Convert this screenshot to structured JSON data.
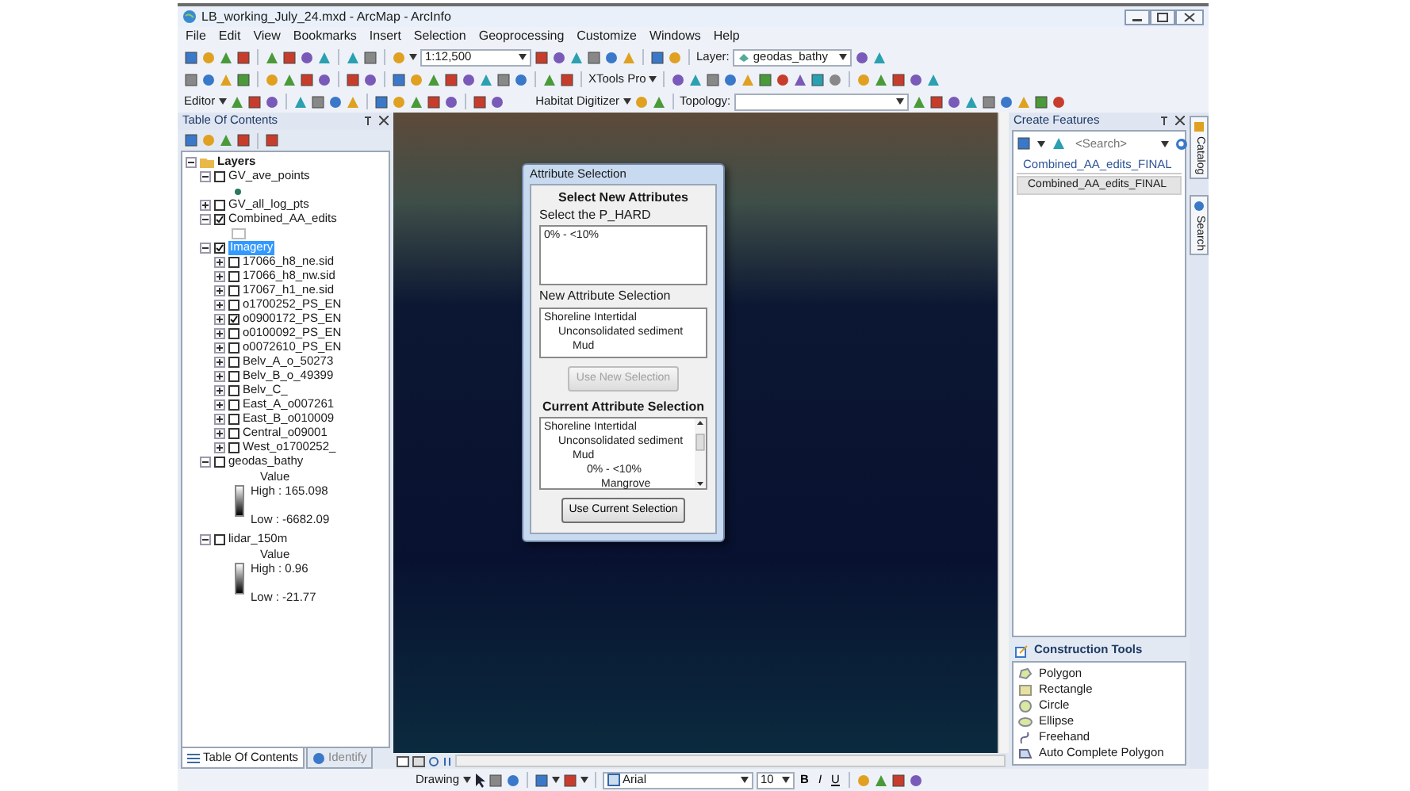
{
  "window": {
    "title": "LB_working_July_24.mxd - ArcMap - ArcInfo"
  },
  "menu": [
    "File",
    "Edit",
    "View",
    "Bookmarks",
    "Insert",
    "Selection",
    "Geoprocessing",
    "Customize",
    "Windows",
    "Help"
  ],
  "standard_toolbar": {
    "scale": "1:12,500",
    "layer_label": "Layer:",
    "layer_value": "geodas_bathy"
  },
  "tools_toolbar": {
    "xtools": "XTools Pro"
  },
  "editor_toolbar": {
    "editor": "Editor",
    "habitat": "Habitat Digitizer",
    "topology": "Topology:"
  },
  "toc": {
    "title": "Table Of Contents",
    "tree": {
      "label": "Layers",
      "expanded": true,
      "children": [
        {
          "label": "GV_ave_points",
          "checked": false,
          "expanded": true,
          "kind": "point"
        },
        {
          "label": "GV_all_log_pts",
          "checked": false,
          "expanded": false
        },
        {
          "label": "Combined_AA_edits",
          "checked": true,
          "expanded": true,
          "kind": "polygon"
        },
        {
          "label": "Imagery",
          "checked": true,
          "expanded": true,
          "selected": true,
          "children": [
            {
              "label": "17066_h8_ne.sid",
              "checked": false,
              "expanded": false
            },
            {
              "label": "17066_h8_nw.sid",
              "checked": false,
              "expanded": false
            },
            {
              "label": "17067_h1_ne.sid",
              "checked": false,
              "expanded": false
            },
            {
              "label": "o1700252_PS_EN",
              "checked": false,
              "expanded": false
            },
            {
              "label": "o0900172_PS_EN",
              "checked": true,
              "expanded": false
            },
            {
              "label": "o0100092_PS_EN",
              "checked": false,
              "expanded": false
            },
            {
              "label": "o0072610_PS_EN",
              "checked": false,
              "expanded": false
            },
            {
              "label": "Belv_A_o_50273",
              "checked": false,
              "expanded": false
            },
            {
              "label": "Belv_B_o_49399",
              "checked": false,
              "expanded": false
            },
            {
              "label": "Belv_C_",
              "checked": false,
              "expanded": false
            },
            {
              "label": "East_A_o007261",
              "checked": false,
              "expanded": false
            },
            {
              "label": "East_B_o010009",
              "checked": false,
              "expanded": false
            },
            {
              "label": "Central_o09001",
              "checked": false,
              "expanded": false
            },
            {
              "label": "West_o1700252_",
              "checked": false,
              "expanded": false
            }
          ]
        },
        {
          "label": "geodas_bathy",
          "checked": false,
          "expanded": true,
          "legend": {
            "title": "Value",
            "high": "High : 165.098",
            "low": "Low : -6682.09"
          }
        },
        {
          "label": "lidar_150m",
          "checked": false,
          "expanded": true,
          "legend": {
            "title": "Value",
            "high": "High : 0.96",
            "low": "Low : -21.77"
          }
        }
      ]
    },
    "tabs": [
      {
        "label": "Table Of Contents",
        "selected": true
      },
      {
        "label": "Identify",
        "selected": false
      }
    ]
  },
  "dialog": {
    "title": "Attribute Selection",
    "heading": "Select New Attributes",
    "list_label": "Select the P_HARD",
    "options": [
      "0% - <10%"
    ],
    "new_label": "New Attribute Selection",
    "new_selection": [
      {
        "label": "Shoreline Intertidal",
        "children": [
          {
            "label": "Unconsolidated sediment",
            "children": [
              {
                "label": "Mud"
              }
            ]
          }
        ]
      }
    ],
    "use_new": {
      "label": "Use New Selection",
      "disabled": true
    },
    "current_heading": "Current Attribute Selection",
    "current_selection": [
      {
        "label": "Shoreline Intertidal",
        "children": [
          {
            "label": "Unconsolidated sediment",
            "children": [
              {
                "label": "Mud",
                "children": [
                  {
                    "label": "0% - <10%",
                    "children": [
                      {
                        "label": "Mangrove"
                      }
                    ]
                  }
                ]
              }
            ]
          }
        ]
      }
    ],
    "use_current": {
      "label": "Use Current Selection",
      "disabled": false
    }
  },
  "create_features": {
    "title": "Create Features",
    "search_placeholder": "<Search>",
    "group": "Combined_AA_edits_FINAL",
    "templates": [
      {
        "label": "Combined_AA_edits_FINAL",
        "selected": true
      }
    ]
  },
  "construction_tools": {
    "title": "Construction Tools",
    "items": [
      {
        "label": "Polygon",
        "kind": "polygon"
      },
      {
        "label": "Rectangle",
        "kind": "rectangle"
      },
      {
        "label": "Circle",
        "kind": "circle"
      },
      {
        "label": "Ellipse",
        "kind": "ellipse"
      },
      {
        "label": "Freehand",
        "kind": "freehand"
      },
      {
        "label": "Auto Complete Polygon",
        "kind": "autocomplete"
      }
    ]
  },
  "side_tabs": [
    "Catalog",
    "Search"
  ],
  "drawing_toolbar": {
    "label": "Drawing",
    "font": "Arial",
    "size": "10",
    "styles": [
      "B",
      "I",
      "U"
    ]
  }
}
